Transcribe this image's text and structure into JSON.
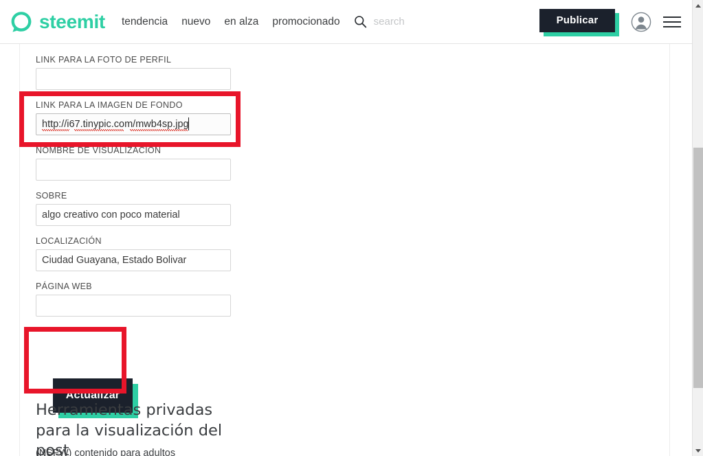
{
  "header": {
    "brand_name": "steemit",
    "logo_icon": "steemit-logo-icon",
    "nav": [
      {
        "label": "tendencia",
        "name": "nav-tendencia"
      },
      {
        "label": "nuevo",
        "name": "nav-nuevo"
      },
      {
        "label": "en alza",
        "name": "nav-en-alza"
      },
      {
        "label": "promocionado",
        "name": "nav-promocionado"
      }
    ],
    "search": {
      "icon": "search-icon",
      "placeholder": "search",
      "value": ""
    },
    "publish_label": "Publicar",
    "avatar_icon": "user-avatar-icon",
    "menu_icon": "hamburger-menu-icon"
  },
  "form": {
    "clipped_fragment": ".",
    "fields": [
      {
        "label": "LINK PARA LA FOTO DE PERFIL",
        "value": "",
        "placeholder": "",
        "name": "profile-picture-url"
      },
      {
        "label": "LINK PARA LA IMAGEN DE FONDO",
        "value": "http://i67.tinypic.com/mwb4sp.jpg",
        "placeholder": "",
        "name": "cover-image-url"
      },
      {
        "label": "NOMBRE DE VISUALIZACIÓN",
        "value": "",
        "placeholder": "",
        "name": "display-name"
      },
      {
        "label": "SOBRE",
        "value": "algo creativo con poco material",
        "placeholder": "",
        "name": "about"
      },
      {
        "label": "LOCALIZACIÓN",
        "value": "Ciudad Guayana, Estado Bolivar",
        "placeholder": "",
        "name": "location"
      },
      {
        "label": "PÁGINA WEB",
        "value": "",
        "placeholder": "",
        "name": "website"
      }
    ],
    "update_label": "Actualizar"
  },
  "private_tools": {
    "heading": "Herramientas privadas para la visualización del post",
    "nsfw_label": "(NSFW) contenido para adultos"
  },
  "annotations": {
    "highlight_color": "#e8152a",
    "boxes": [
      {
        "name": "annotation-cover-image-field",
        "label": "LINK PARA LA IMAGEN DE FONDO"
      },
      {
        "name": "annotation-update-button",
        "label": "Actualizar"
      }
    ]
  },
  "colors": {
    "brand_teal": "#2ecfa4",
    "button_dark": "#1b212c",
    "annotation_red": "#e8152a",
    "text_dark": "#3a3d40",
    "placeholder_grey": "#c4c6c8"
  },
  "scrollbar": {
    "up_icon": "scroll-up-arrow-icon",
    "down_icon": "scroll-down-arrow-icon"
  }
}
